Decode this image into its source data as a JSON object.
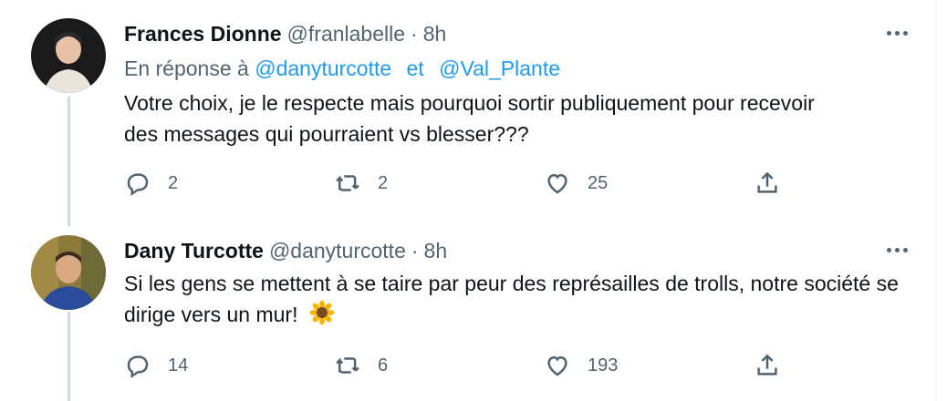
{
  "tweets": [
    {
      "name": "Frances Dionne",
      "handle": "@franlabelle",
      "separator": "·",
      "time": "8h",
      "reply_prefix": "En réponse à",
      "mentions": [
        "@danyturcotte",
        "@Val_Plante"
      ],
      "mention_joiner": "et",
      "text": "Votre choix, je le respecte mais pourquoi sortir publiquement pour recevoir des messages qui pourraient vs blesser???",
      "counts": {
        "reply": "2",
        "retweet": "2",
        "like": "25"
      }
    },
    {
      "name": "Dany Turcotte",
      "handle": "@danyturcotte",
      "separator": "·",
      "time": "8h",
      "text": "Si les gens se mettent à se taire par peur des représailles de trolls, notre société se dirige vers un mur!",
      "emoji_icon": "sunflower-icon",
      "counts": {
        "reply": "14",
        "retweet": "6",
        "like": "193"
      }
    }
  ],
  "colors": {
    "text": "#0f1419",
    "secondary": "#536471",
    "link": "#1d9bf0",
    "thread": "#cfd9de"
  }
}
